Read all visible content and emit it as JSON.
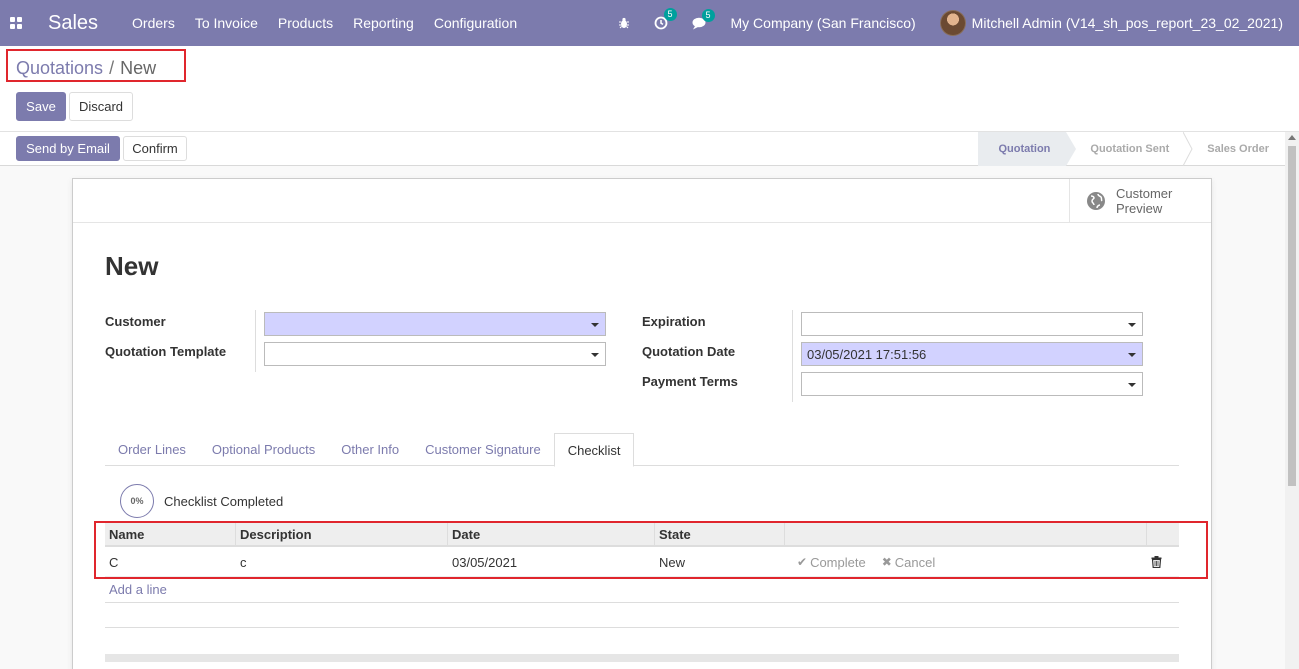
{
  "navbar": {
    "app_name": "Sales",
    "menu": [
      "Orders",
      "To Invoice",
      "Products",
      "Reporting",
      "Configuration"
    ],
    "activity_count": "5",
    "message_count": "5",
    "company": "My Company (San Francisco)",
    "user": "Mitchell Admin (V14_sh_pos_report_23_02_2021)",
    "accent_color": "#7c7bad"
  },
  "breadcrumb": {
    "parent": "Quotations",
    "separator": "/",
    "current": "New"
  },
  "buttons": {
    "save": "Save",
    "discard": "Discard",
    "send_email": "Send by Email",
    "confirm": "Confirm"
  },
  "status": [
    "Quotation",
    "Quotation Sent",
    "Sales Order"
  ],
  "smart_button": {
    "label_line1": "Customer",
    "label_line2": "Preview",
    "icon": "globe-icon"
  },
  "form": {
    "title": "New",
    "customer_label": "Customer",
    "customer_value": "",
    "template_label": "Quotation Template",
    "template_value": "",
    "expiration_label": "Expiration",
    "expiration_value": "",
    "quotation_date_label": "Quotation Date",
    "quotation_date_value": "03/05/2021 17:51:56",
    "payment_terms_label": "Payment Terms",
    "payment_terms_value": ""
  },
  "tabs": [
    "Order Lines",
    "Optional Products",
    "Other Info",
    "Customer Signature",
    "Checklist"
  ],
  "checklist": {
    "progress": "0%",
    "progress_label": "Checklist Completed",
    "columns": [
      "Name",
      "Description",
      "Date",
      "State"
    ],
    "rows": [
      {
        "name": "C",
        "description": "c",
        "date": "03/05/2021",
        "state": "New",
        "complete": "Complete",
        "cancel": "Cancel"
      }
    ],
    "add_line": "Add a line"
  }
}
